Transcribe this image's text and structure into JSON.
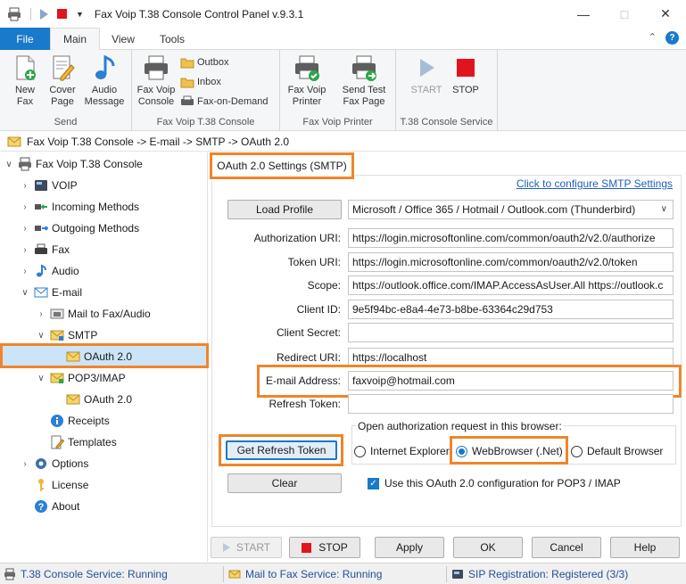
{
  "window": {
    "title": "Fax Voip T.38 Console Control Panel v.9.3.1"
  },
  "ribbon_tabs": [
    "File",
    "Main",
    "View",
    "Tools"
  ],
  "ribbon": {
    "send_group": {
      "label": "Send",
      "new_fax": "New Fax",
      "cover_page": "Cover Page",
      "audio_message": "Audio Message"
    },
    "console_group": {
      "label": "Fax Voip T.38 Console",
      "console": "Fax Voip Console",
      "outbox": "Outbox",
      "inbox": "Inbox",
      "fax_on_demand": "Fax-on-Demand"
    },
    "printer_group": {
      "label": "Fax Voip Printer",
      "printer": "Fax Voip Printer",
      "send_test": "Send Test Fax Page"
    },
    "service_group": {
      "label": "T.38 Console Service",
      "start": "START",
      "stop": "STOP"
    }
  },
  "breadcrumb": "Fax Voip T.38 Console -> E-mail -> SMTP -> OAuth 2.0",
  "tree": {
    "root": "Fax Voip T.38 Console",
    "voip": "VOIP",
    "incoming": "Incoming Methods",
    "outgoing": "Outgoing Methods",
    "fax": "Fax",
    "audio": "Audio",
    "email": "E-mail",
    "mail_to_fax": "Mail to Fax/Audio",
    "smtp": "SMTP",
    "smtp_oauth": "OAuth 2.0",
    "pop3": "POP3/IMAP",
    "pop3_oauth": "OAuth 2.0",
    "receipts": "Receipts",
    "templates": "Templates",
    "options": "Options",
    "license": "License",
    "about": "About"
  },
  "panel": {
    "title": "OAuth 2.0 Settings (SMTP)",
    "config_link": "Click to configure SMTP Settings",
    "load_profile": "Load Profile",
    "profile_value": "Microsoft / Office 365 / Hotmail / Outlook.com (Thunderbird)",
    "fields": {
      "auth_uri": {
        "label": "Authorization URI:",
        "value": "https://login.microsoftonline.com/common/oauth2/v2.0/authorize"
      },
      "token_uri": {
        "label": "Token URI:",
        "value": "https://login.microsoftonline.com/common/oauth2/v2.0/token"
      },
      "scope": {
        "label": "Scope:",
        "value": "https://outlook.office.com/IMAP.AccessAsUser.All https://outlook.c"
      },
      "client_id": {
        "label": "Client ID:",
        "value": "9e5f94bc-e8a4-4e73-b8be-63364c29d753"
      },
      "client_secret": {
        "label": "Client Secret:",
        "value": ""
      },
      "redirect_uri": {
        "label": "Redirect URI:",
        "value": "https://localhost"
      },
      "email": {
        "label": "E-mail Address:",
        "value": "faxvoip@hotmail.com"
      },
      "refresh_token": {
        "label": "Refresh Token:",
        "value": ""
      }
    },
    "browser_group_label": "Open authorization request in this browser:",
    "browsers": [
      "Internet Explorer",
      "WebBrowser (.Net)",
      "Default Browser"
    ],
    "selected_browser": "WebBrowser (.Net)",
    "get_refresh_token": "Get Refresh Token",
    "clear": "Clear",
    "use_for_pop3": "Use this OAuth 2.0 configuration for POP3 / IMAP"
  },
  "bottom_buttons": {
    "start": "START",
    "stop": "STOP",
    "apply": "Apply",
    "ok": "OK",
    "cancel": "Cancel",
    "help": "Help"
  },
  "status": {
    "t38": "T.38 Console Service: Running",
    "mail_to_fax": "Mail to Fax Service: Running",
    "sip": "SIP Registration: Registered (3/3)"
  },
  "colors": {
    "accent": "#1979ca",
    "highlight": "#f08529",
    "selection": "#cce4f7",
    "stop_red": "#e0141e"
  }
}
